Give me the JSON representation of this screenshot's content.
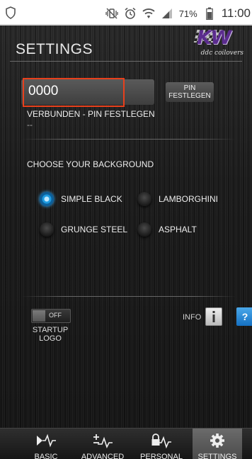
{
  "status_bar": {
    "battery_percent": "71%",
    "time": "11:00"
  },
  "header": {
    "title": "SETTINGS",
    "logo_text": "KW",
    "logo_tagline": "ddc coilovers"
  },
  "pin": {
    "value": "0000",
    "button_label_line1": "PIN",
    "button_label_line2": "FESTLEGEN",
    "status": "VERBUNDEN - PIN FESTLEGEN",
    "substatus": "--"
  },
  "background": {
    "title": "CHOOSE YOUR BACKGROUND",
    "options": [
      {
        "label": "SIMPLE BLACK",
        "selected": true
      },
      {
        "label": "LAMBORGHINI",
        "selected": false
      },
      {
        "label": "GRUNGE STEEL",
        "selected": false
      },
      {
        "label": "ASPHALT",
        "selected": false
      }
    ]
  },
  "startup": {
    "toggle_state": "OFF",
    "label_line1": "STARTUP",
    "label_line2": "LOGO"
  },
  "info": {
    "label": "INFO",
    "help_symbol": "?"
  },
  "nav": {
    "items": [
      {
        "label": "BASIC",
        "icon": "pulse-arrow-icon",
        "active": false
      },
      {
        "label": "ADVANCED",
        "icon": "plus-minus-pulse-icon",
        "active": false
      },
      {
        "label": "PERSONAL",
        "icon": "lock-pulse-icon",
        "active": false
      },
      {
        "label": "SETTINGS",
        "icon": "gear-icon",
        "active": true
      }
    ]
  },
  "colors": {
    "accent_red": "#e8401c",
    "radio_blue": "#1e9be0",
    "logo_purple": "#5b2c8e"
  }
}
